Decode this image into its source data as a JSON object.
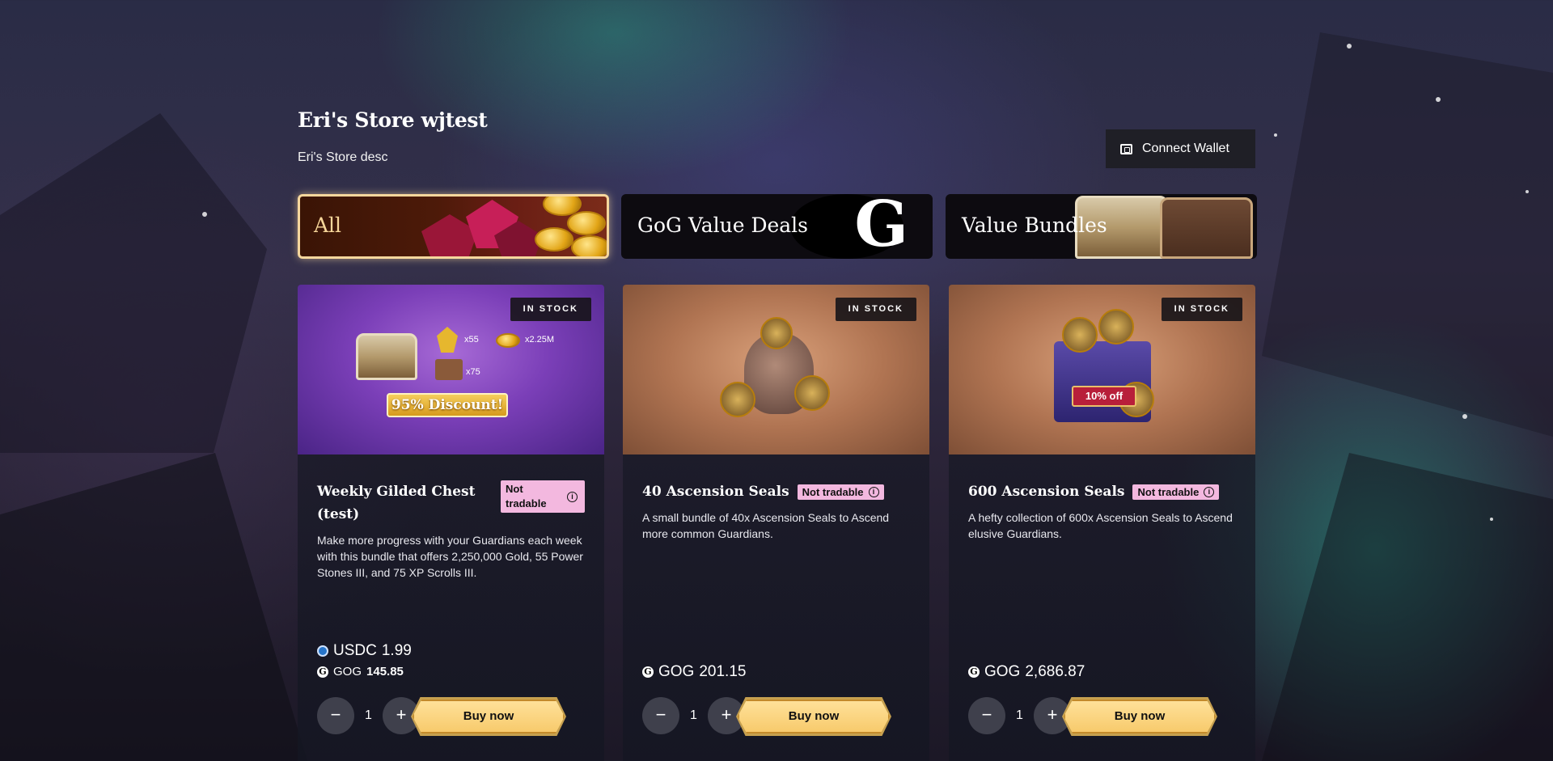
{
  "store": {
    "title": "Eri's Store wjtest",
    "description": "Eri's Store desc"
  },
  "wallet": {
    "label": "Connect Wallet",
    "icon": "wallet-icon"
  },
  "categories": [
    {
      "label": "All",
      "selected": true
    },
    {
      "label": "GoG Value Deals",
      "selected": false
    },
    {
      "label": "Value Bundles",
      "selected": false
    }
  ],
  "products": [
    {
      "stock": "IN STOCK",
      "title": "Weekly Gilded Chest (test)",
      "badge": "Not tradable",
      "description": "Make more progress with your Guardians each week with this bundle that offers 2,250,000 Gold, 55 Power Stones III, and 75 XP Scrolls III.",
      "image_text": {
        "stones": "x55",
        "gold": "x2.25M",
        "scrolls": "x75",
        "banner": "95% Discount!"
      },
      "prices": [
        {
          "currency": "USDC",
          "amount": "1.99",
          "icon": "usdc-icon"
        },
        {
          "currency": "GOG",
          "amount": "145.85",
          "icon": "gog-icon"
        }
      ],
      "quantity": "1",
      "buy_label": "Buy now"
    },
    {
      "stock": "IN STOCK",
      "title": "40 Ascension Seals",
      "badge": "Not tradable",
      "description": "A small bundle of 40x Ascension Seals to Ascend more common Guardians.",
      "prices": [
        {
          "currency": "GOG",
          "amount": "201.15",
          "icon": "gog-icon"
        }
      ],
      "quantity": "1",
      "buy_label": "Buy now"
    },
    {
      "stock": "IN STOCK",
      "title": "600 Ascension Seals",
      "badge": "Not tradable",
      "description": "A hefty collection of 600x Ascension Seals to Ascend elusive Guardians.",
      "image_text": {
        "ribbon": "10% off"
      },
      "prices": [
        {
          "currency": "GOG",
          "amount": "2,686.87",
          "icon": "gog-icon"
        }
      ],
      "quantity": "1",
      "buy_label": "Buy now"
    }
  ],
  "qty_controls": {
    "minus": "−",
    "plus": "+"
  },
  "colors": {
    "accent_gold": "#f6d79d",
    "badge_pink": "#f3b8df",
    "buy_gold": "#f7c96a"
  }
}
